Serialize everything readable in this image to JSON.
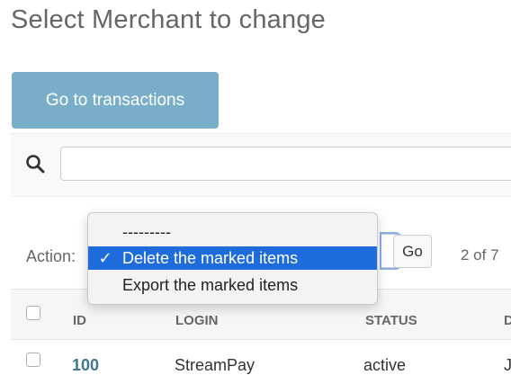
{
  "page": {
    "title": "Select Merchant to change"
  },
  "toolbar": {
    "go_to_transactions": "Go to transactions"
  },
  "search": {
    "value": "",
    "placeholder": ""
  },
  "actions": {
    "label": "Action:",
    "options": [
      "---------",
      "Delete the marked items",
      "Export the marked items"
    ],
    "selected_index": 1,
    "go_label": "Go",
    "counter": "2 of 7"
  },
  "table": {
    "columns": [
      "ID",
      "LOGIN",
      "STATUS",
      "D"
    ],
    "rows": [
      {
        "id": "100",
        "login": "StreamPay",
        "status": "active",
        "d": "J"
      }
    ]
  }
}
